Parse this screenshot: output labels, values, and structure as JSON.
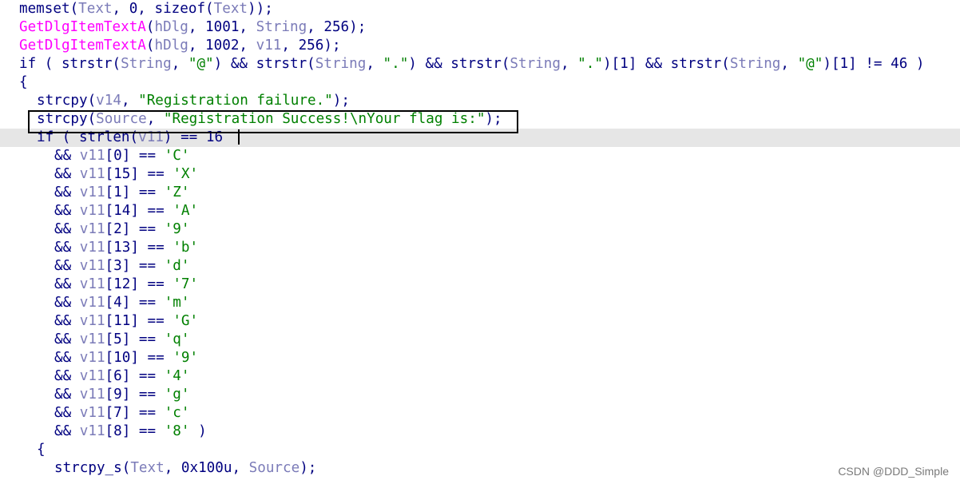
{
  "colors": {
    "keyword": "#000080",
    "api_call": "#ff00ff",
    "variable": "#7b7bb8",
    "string": "#008000",
    "current_line_bg": "#e6e6e6",
    "highlight_border": "#000000",
    "watermark": "#7a7a7a"
  },
  "code_lines": [
    {
      "indent": 0,
      "tokens": [
        [
          "fn",
          "memset"
        ],
        [
          "op",
          "("
        ],
        [
          "var",
          "Text"
        ],
        [
          "op",
          ", 0, sizeof("
        ],
        [
          "var",
          "Text"
        ],
        [
          "op",
          "));"
        ]
      ]
    },
    {
      "indent": 0,
      "tokens": [
        [
          "api",
          "GetDlgItemTextA"
        ],
        [
          "op",
          "("
        ],
        [
          "var",
          "hDlg"
        ],
        [
          "op",
          ", 1001, "
        ],
        [
          "var",
          "String"
        ],
        [
          "op",
          ", 256);"
        ]
      ]
    },
    {
      "indent": 0,
      "tokens": [
        [
          "api",
          "GetDlgItemTextA"
        ],
        [
          "op",
          "("
        ],
        [
          "var",
          "hDlg"
        ],
        [
          "op",
          ", 1002, "
        ],
        [
          "var",
          "v11"
        ],
        [
          "op",
          ", 256);"
        ]
      ]
    },
    {
      "indent": 0,
      "tokens": [
        [
          "kw",
          "if"
        ],
        [
          "op",
          " ( strstr("
        ],
        [
          "var",
          "String"
        ],
        [
          "op",
          ", "
        ],
        [
          "str",
          "\"@\""
        ],
        [
          "op",
          ") && strstr("
        ],
        [
          "var",
          "String"
        ],
        [
          "op",
          ", "
        ],
        [
          "str",
          "\".\""
        ],
        [
          "op",
          ") && strstr("
        ],
        [
          "var",
          "String"
        ],
        [
          "op",
          ", "
        ],
        [
          "str",
          "\".\""
        ],
        [
          "op",
          ")[1] && strstr("
        ],
        [
          "var",
          "String"
        ],
        [
          "op",
          ", "
        ],
        [
          "str",
          "\"@\""
        ],
        [
          "op",
          ")[1] != 46 )"
        ]
      ]
    },
    {
      "indent": 0,
      "tokens": [
        [
          "op",
          "{"
        ]
      ]
    },
    {
      "indent": 1,
      "tokens": [
        [
          "fn",
          "strcpy"
        ],
        [
          "op",
          "("
        ],
        [
          "var",
          "v14"
        ],
        [
          "op",
          ", "
        ],
        [
          "str",
          "\"Registration failure.\""
        ],
        [
          "op",
          ");"
        ]
      ]
    },
    {
      "indent": 1,
      "tokens": [
        [
          "fn",
          "strcpy"
        ],
        [
          "op",
          "("
        ],
        [
          "var",
          "Source"
        ],
        [
          "op",
          ", "
        ],
        [
          "str",
          "\"Registration Success!\\nYour flag is:\""
        ],
        [
          "op",
          ");"
        ]
      ]
    },
    {
      "indent": 1,
      "current": true,
      "tokens": [
        [
          "kw",
          "if"
        ],
        [
          "op",
          " ( strlen("
        ],
        [
          "var",
          "v11"
        ],
        [
          "op",
          ") == 16"
        ]
      ]
    },
    {
      "indent": 2,
      "tokens": [
        [
          "op",
          "&& "
        ],
        [
          "var",
          "v11"
        ],
        [
          "op",
          "[0] == "
        ],
        [
          "str",
          "'C'"
        ]
      ]
    },
    {
      "indent": 2,
      "tokens": [
        [
          "op",
          "&& "
        ],
        [
          "var",
          "v11"
        ],
        [
          "op",
          "[15] == "
        ],
        [
          "str",
          "'X'"
        ]
      ]
    },
    {
      "indent": 2,
      "tokens": [
        [
          "op",
          "&& "
        ],
        [
          "var",
          "v11"
        ],
        [
          "op",
          "[1] == "
        ],
        [
          "str",
          "'Z'"
        ]
      ]
    },
    {
      "indent": 2,
      "tokens": [
        [
          "op",
          "&& "
        ],
        [
          "var",
          "v11"
        ],
        [
          "op",
          "[14] == "
        ],
        [
          "str",
          "'A'"
        ]
      ]
    },
    {
      "indent": 2,
      "tokens": [
        [
          "op",
          "&& "
        ],
        [
          "var",
          "v11"
        ],
        [
          "op",
          "[2] == "
        ],
        [
          "str",
          "'9'"
        ]
      ]
    },
    {
      "indent": 2,
      "tokens": [
        [
          "op",
          "&& "
        ],
        [
          "var",
          "v11"
        ],
        [
          "op",
          "[13] == "
        ],
        [
          "str",
          "'b'"
        ]
      ]
    },
    {
      "indent": 2,
      "tokens": [
        [
          "op",
          "&& "
        ],
        [
          "var",
          "v11"
        ],
        [
          "op",
          "[3] == "
        ],
        [
          "str",
          "'d'"
        ]
      ]
    },
    {
      "indent": 2,
      "tokens": [
        [
          "op",
          "&& "
        ],
        [
          "var",
          "v11"
        ],
        [
          "op",
          "[12] == "
        ],
        [
          "str",
          "'7'"
        ]
      ]
    },
    {
      "indent": 2,
      "tokens": [
        [
          "op",
          "&& "
        ],
        [
          "var",
          "v11"
        ],
        [
          "op",
          "[4] == "
        ],
        [
          "str",
          "'m'"
        ]
      ]
    },
    {
      "indent": 2,
      "tokens": [
        [
          "op",
          "&& "
        ],
        [
          "var",
          "v11"
        ],
        [
          "op",
          "[11] == "
        ],
        [
          "str",
          "'G'"
        ]
      ]
    },
    {
      "indent": 2,
      "tokens": [
        [
          "op",
          "&& "
        ],
        [
          "var",
          "v11"
        ],
        [
          "op",
          "[5] == "
        ],
        [
          "str",
          "'q'"
        ]
      ]
    },
    {
      "indent": 2,
      "tokens": [
        [
          "op",
          "&& "
        ],
        [
          "var",
          "v11"
        ],
        [
          "op",
          "[10] == "
        ],
        [
          "str",
          "'9'"
        ]
      ]
    },
    {
      "indent": 2,
      "tokens": [
        [
          "op",
          "&& "
        ],
        [
          "var",
          "v11"
        ],
        [
          "op",
          "[6] == "
        ],
        [
          "str",
          "'4'"
        ]
      ]
    },
    {
      "indent": 2,
      "tokens": [
        [
          "op",
          "&& "
        ],
        [
          "var",
          "v11"
        ],
        [
          "op",
          "[9] == "
        ],
        [
          "str",
          "'g'"
        ]
      ]
    },
    {
      "indent": 2,
      "tokens": [
        [
          "op",
          "&& "
        ],
        [
          "var",
          "v11"
        ],
        [
          "op",
          "[7] == "
        ],
        [
          "str",
          "'c'"
        ]
      ]
    },
    {
      "indent": 2,
      "tokens": [
        [
          "op",
          "&& "
        ],
        [
          "var",
          "v11"
        ],
        [
          "op",
          "[8] == "
        ],
        [
          "str",
          "'8'"
        ],
        [
          "op",
          " )"
        ]
      ]
    },
    {
      "indent": 1,
      "tokens": [
        [
          "op",
          "{"
        ]
      ]
    },
    {
      "indent": 2,
      "tokens": [
        [
          "fn",
          "strcpy_s"
        ],
        [
          "op",
          "("
        ],
        [
          "var",
          "Text"
        ],
        [
          "op",
          ", 0x100u, "
        ],
        [
          "var",
          "Source"
        ],
        [
          "op",
          ");"
        ]
      ]
    }
  ],
  "highlighted_line_index": 6,
  "watermark": "CSDN @DDD_Simple"
}
